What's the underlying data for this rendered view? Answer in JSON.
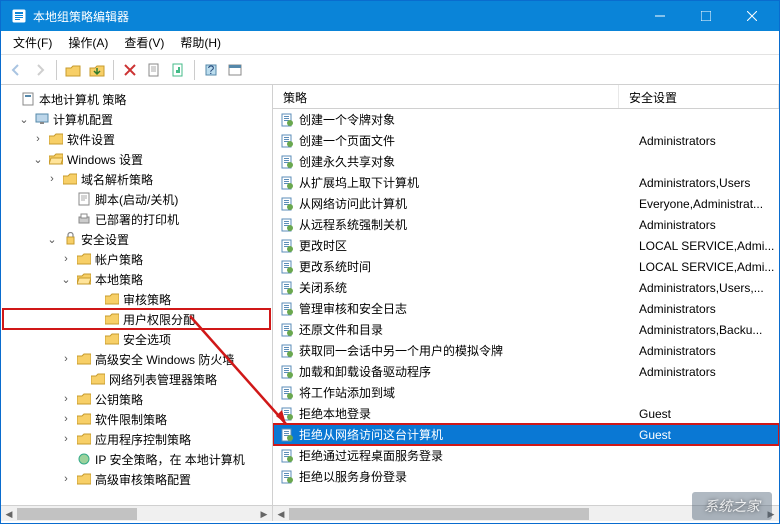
{
  "window": {
    "title": "本地组策略编辑器"
  },
  "menu": {
    "file": "文件(F)",
    "action": "操作(A)",
    "view": "查看(V)",
    "help": "帮助(H)"
  },
  "tree": {
    "root": "本地计算机 策略",
    "n_computer": "计算机配置",
    "n_software": "软件设置",
    "n_windows": "Windows 设置",
    "n_dns": "域名解析策略",
    "n_script": "脚本(启动/关机)",
    "n_printers": "已部署的打印机",
    "n_security": "安全设置",
    "n_account": "帐户策略",
    "n_local": "本地策略",
    "n_audit": "审核策略",
    "n_rights": "用户权限分配",
    "n_secopt": "安全选项",
    "n_firewall": "高级安全 Windows 防火墙",
    "n_netlist": "网络列表管理器策略",
    "n_pubkey": "公钥策略",
    "n_softrestr": "软件限制策略",
    "n_appctrl": "应用程序控制策略",
    "n_ipsec": "IP 安全策略，在 本地计算机",
    "n_advaudit": "高级审核策略配置"
  },
  "columns": {
    "policy": "策略",
    "setting": "安全设置"
  },
  "items": [
    {
      "name": "创建一个令牌对象",
      "val": ""
    },
    {
      "name": "创建一个页面文件",
      "val": "Administrators"
    },
    {
      "name": "创建永久共享对象",
      "val": ""
    },
    {
      "name": "从扩展坞上取下计算机",
      "val": "Administrators,Users"
    },
    {
      "name": "从网络访问此计算机",
      "val": "Everyone,Administrat..."
    },
    {
      "name": "从远程系统强制关机",
      "val": "Administrators"
    },
    {
      "name": "更改时区",
      "val": "LOCAL SERVICE,Admi..."
    },
    {
      "name": "更改系统时间",
      "val": "LOCAL SERVICE,Admi..."
    },
    {
      "name": "关闭系统",
      "val": "Administrators,Users,..."
    },
    {
      "name": "管理审核和安全日志",
      "val": "Administrators"
    },
    {
      "name": "还原文件和目录",
      "val": "Administrators,Backu..."
    },
    {
      "name": "获取同一会话中另一个用户的模拟令牌",
      "val": "Administrators"
    },
    {
      "name": "加载和卸载设备驱动程序",
      "val": "Administrators"
    },
    {
      "name": "将工作站添加到域",
      "val": ""
    },
    {
      "name": "拒绝本地登录",
      "val": "Guest"
    },
    {
      "name": "拒绝从网络访问这台计算机",
      "val": "Guest"
    },
    {
      "name": "拒绝通过远程桌面服务登录",
      "val": ""
    },
    {
      "name": "拒绝以服务身份登录",
      "val": ""
    }
  ],
  "watermark": "系统之家"
}
